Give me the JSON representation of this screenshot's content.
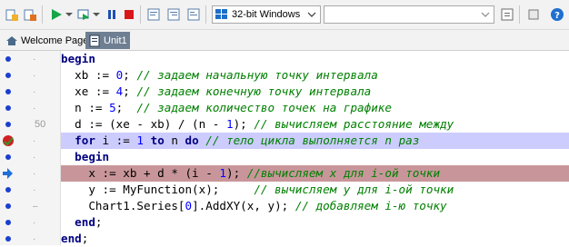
{
  "toolbar": {
    "platform_label": "32-bit Windows",
    "config_value": ""
  },
  "tabs": [
    {
      "label": "Welcome Page"
    },
    {
      "label": "Unit1"
    }
  ],
  "gutter": {
    "line_number_50": "50",
    "tick": "·",
    "dash": "–"
  },
  "code": [
    [
      {
        "t": "begin",
        "c": "kw"
      }
    ],
    [
      {
        "t": "  xb := ",
        "c": "ident"
      },
      {
        "t": "0",
        "c": "num"
      },
      {
        "t": "; ",
        "c": "ident"
      },
      {
        "t": "// задаем начальную точку интервала",
        "c": "cmt"
      }
    ],
    [
      {
        "t": "  xe := ",
        "c": "ident"
      },
      {
        "t": "4",
        "c": "num"
      },
      {
        "t": "; ",
        "c": "ident"
      },
      {
        "t": "// задаем конечную точку интервала",
        "c": "cmt"
      }
    ],
    [
      {
        "t": "  n := ",
        "c": "ident"
      },
      {
        "t": "5",
        "c": "num"
      },
      {
        "t": ";  ",
        "c": "ident"
      },
      {
        "t": "// задаем количество точек на графике",
        "c": "cmt"
      }
    ],
    [
      {
        "t": "  d := (xe - xb) / (n - ",
        "c": "ident"
      },
      {
        "t": "1",
        "c": "num"
      },
      {
        "t": "); ",
        "c": "ident"
      },
      {
        "t": "// вычисляем расстояние между",
        "c": "cmt"
      }
    ],
    [
      {
        "t": "  ",
        "c": "ident"
      },
      {
        "t": "for",
        "c": "kw"
      },
      {
        "t": " i := ",
        "c": "ident"
      },
      {
        "t": "1",
        "c": "num"
      },
      {
        "t": " ",
        "c": "ident"
      },
      {
        "t": "to",
        "c": "kw"
      },
      {
        "t": " n ",
        "c": "ident"
      },
      {
        "t": "do",
        "c": "kw"
      },
      {
        "t": " ",
        "c": "ident"
      },
      {
        "t": "// тело цикла выполняется n раз",
        "c": "cmt"
      }
    ],
    [
      {
        "t": "  ",
        "c": "ident"
      },
      {
        "t": "begin",
        "c": "kw"
      }
    ],
    [
      {
        "t": "    x := xb + d * (i - ",
        "c": "ident"
      },
      {
        "t": "1",
        "c": "num"
      },
      {
        "t": "); ",
        "c": "ident"
      },
      {
        "t": "//вычисляем x для i-ой точки",
        "c": "cmt"
      }
    ],
    [
      {
        "t": "    y := MyFunction(x);     ",
        "c": "ident"
      },
      {
        "t": "// вычисляем y для i-ой точки",
        "c": "cmt"
      }
    ],
    [
      {
        "t": "    Chart1.Series[",
        "c": "ident"
      },
      {
        "t": "0",
        "c": "num"
      },
      {
        "t": "].AddXY(x, y); ",
        "c": "ident"
      },
      {
        "t": "// добавляем i-ю точку",
        "c": "cmt"
      }
    ],
    [
      {
        "t": "  ",
        "c": "ident"
      },
      {
        "t": "end",
        "c": "kw"
      },
      {
        "t": ";",
        "c": "ident"
      }
    ],
    [
      {
        "t": "end",
        "c": "kw"
      },
      {
        "t": ";",
        "c": "ident"
      }
    ]
  ],
  "colors": {
    "breakpoint_line": "#ccccff",
    "execution_line": "#c8969a",
    "keyword": "#000080",
    "number": "#0000ff",
    "comment": "#008000"
  }
}
